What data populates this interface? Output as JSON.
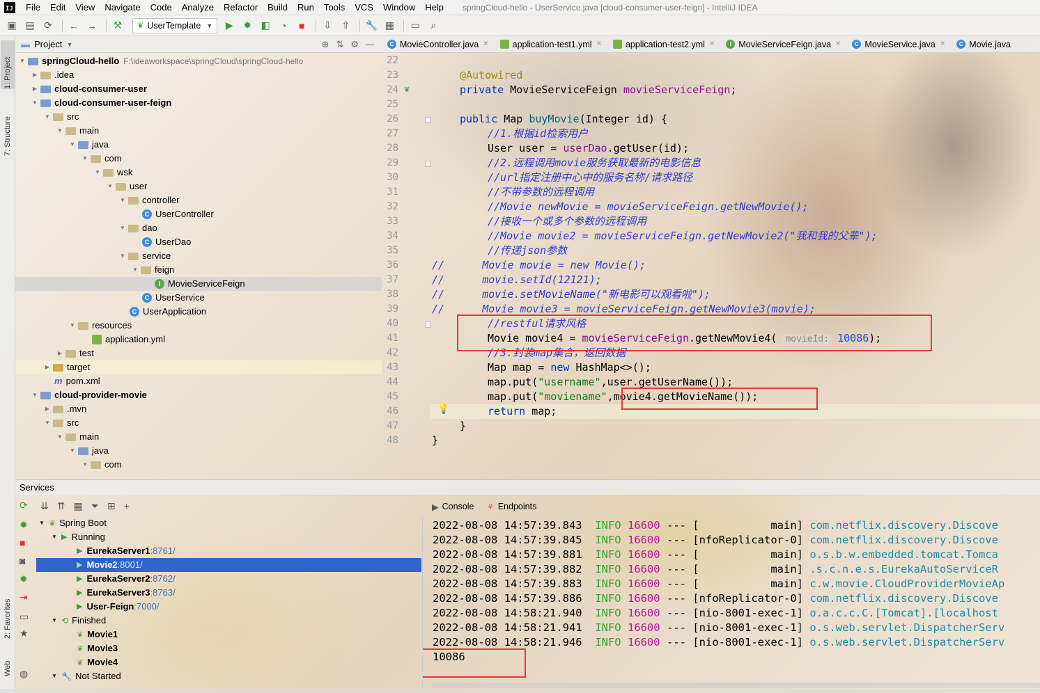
{
  "window": {
    "title": "springCloud-hello - UserService.java [cloud-consumer-user-feign] - IntelliJ IDEA"
  },
  "menu": [
    "File",
    "Edit",
    "View",
    "Navigate",
    "Code",
    "Analyze",
    "Refactor",
    "Build",
    "Run",
    "Tools",
    "VCS",
    "Window",
    "Help"
  ],
  "toolbar": {
    "run_config": "UserTemplate"
  },
  "left_strip": {
    "project": "1: Project",
    "structure": "7: Structure",
    "favorites": "2: Favorites",
    "web": "Web"
  },
  "project_panel": {
    "title": "Project",
    "root_name": "springCloud-hello",
    "root_path": "F:\\ideaworkspace\\springCloud\\springCloud-hello",
    "items": [
      "springCloud-hello",
      ".idea",
      "cloud-consumer-user",
      "cloud-consumer-user-feign",
      "src",
      "main",
      "java",
      "com",
      "wsk",
      "user",
      "controller",
      "UserController",
      "dao",
      "UserDao",
      "service",
      "feign",
      "MovieServiceFeign",
      "UserService",
      "UserApplication",
      "resources",
      "application.yml",
      "test",
      "target",
      "pom.xml",
      "cloud-provider-movie",
      ".mvn",
      "src",
      "main",
      "java",
      "com"
    ]
  },
  "editor": {
    "tabs": [
      "MovieController.java",
      "application-test1.yml",
      "application-test2.yml",
      "MovieServiceFeign.java",
      "MovieService.java",
      "Movie.java"
    ],
    "line_numbers": [
      "22",
      "23",
      "24",
      "25",
      "26",
      "27",
      "28",
      "29",
      "30",
      "31",
      "32",
      "33",
      "34",
      "35",
      "36",
      "37",
      "38",
      "39",
      "40",
      "41",
      "42",
      "43",
      "44",
      "45",
      "46",
      "47",
      "48"
    ],
    "lines": {
      "l23": "@Autowired",
      "l24a": "private ",
      "l24b": "MovieServiceFeign ",
      "l24c": "movieServiceFeign",
      "l26a": "public ",
      "l26b": "Map ",
      "l26c": "buyMovie",
      "l26d": "(Integer id) {",
      "l27": "//1.根据id检索用户",
      "l28a": "User user = ",
      "l28b": "userDao",
      "l28c": ".getUser(id);",
      "l29": "//2.远程调用movie服务获取最新的电影信息",
      "l30": "//url指定注册中心中的服务名称/请求路径",
      "l31": "//不带参数的远程调用",
      "l32": "//Movie newMovie = movieServiceFeign.getNewMovie();",
      "l33": "//接收一个或多个参数的远程调用",
      "l34": "//Movie movie2 = movieServiceFeign.getNewMovie2(\"我和我的父辈\");",
      "l35": "//传递json参数",
      "l36": "//      Movie movie = new Movie();",
      "l37": "//      movie.setId(12121);",
      "l38": "//      movie.setMovieName(\"新电影可以观看啦\");",
      "l39": "//      Movie movie3 = movieServiceFeign.getNewMovie3(movie);",
      "l40": "//restful请求风格",
      "l41a": "Movie movie4 = ",
      "l41b": "movieServiceFeign",
      "l41c": ".getNewMovie4( ",
      "l41hint": "movieId:",
      "l41num": "10086",
      "l41d": ");",
      "l42": "//3.封装map集合，返回数据",
      "l43a": "Map map = ",
      "l43b": "new ",
      "l43c": "HashMap<>();",
      "l44a": "map.put(",
      "l44b": "\"username\"",
      "l44c": ",user.getUserName());",
      "l45a": "map.put(",
      "l45b": "\"moviename\"",
      "l45c": ",movie4.getMovieName());",
      "l46a": "return ",
      "l46b": "map;",
      "l47": "}",
      "l48": "}"
    }
  },
  "services": {
    "title": "Services",
    "tree": {
      "spring_boot": "Spring Boot",
      "running": "Running",
      "eureka1": "EurekaServer1",
      "eureka1_port": ":8761/",
      "movie2": "Movie2",
      "movie2_port": ":8001/",
      "eureka2": "EurekaServer2",
      "eureka2_port": ":8762/",
      "eureka3": "EurekaServer3",
      "eureka3_port": ":8763/",
      "userfeign": "User-Feign",
      "userfeign_port": ":7000/",
      "finished": "Finished",
      "movie1": "Movie1",
      "movie3": "Movie3",
      "movie4": "Movie4",
      "not_started": "Not Started"
    },
    "console_tab": "Console",
    "endpoints_tab": "Endpoints",
    "log": [
      {
        "ts": "2022-08-08 14:57:39.843",
        "level": "INFO",
        "pid": "16600",
        "sep": "---",
        "thread": "[           main]",
        "cls": "com.netflix.discovery.Discove"
      },
      {
        "ts": "2022-08-08 14:57:39.845",
        "level": "INFO",
        "pid": "16600",
        "sep": "---",
        "thread": "[nfoReplicator-0]",
        "cls": "com.netflix.discovery.Discove"
      },
      {
        "ts": "2022-08-08 14:57:39.881",
        "level": "INFO",
        "pid": "16600",
        "sep": "---",
        "thread": "[           main]",
        "cls": "o.s.b.w.embedded.tomcat.Tomca"
      },
      {
        "ts": "2022-08-08 14:57:39.882",
        "level": "INFO",
        "pid": "16600",
        "sep": "---",
        "thread": "[           main]",
        "cls": ".s.c.n.e.s.EurekaAutoServiceR"
      },
      {
        "ts": "2022-08-08 14:57:39.883",
        "level": "INFO",
        "pid": "16600",
        "sep": "---",
        "thread": "[           main]",
        "cls": "c.w.movie.CloudProviderMovieAp"
      },
      {
        "ts": "2022-08-08 14:57:39.886",
        "level": "INFO",
        "pid": "16600",
        "sep": "---",
        "thread": "[nfoReplicator-0]",
        "cls": "com.netflix.discovery.Discove"
      },
      {
        "ts": "2022-08-08 14:58:21.940",
        "level": "INFO",
        "pid": "16600",
        "sep": "---",
        "thread": "[nio-8001-exec-1]",
        "cls": "o.a.c.c.C.[Tomcat].[localhost"
      },
      {
        "ts": "2022-08-08 14:58:21.941",
        "level": "INFO",
        "pid": "16600",
        "sep": "---",
        "thread": "[nio-8001-exec-1]",
        "cls": "o.s.web.servlet.DispatcherServ"
      },
      {
        "ts": "2022-08-08 14:58:21.946",
        "level": "INFO",
        "pid": "16600",
        "sep": "---",
        "thread": "[nio-8001-exec-1]",
        "cls": "o.s.web.servlet.DispatcherServ"
      }
    ],
    "output": "10086"
  }
}
